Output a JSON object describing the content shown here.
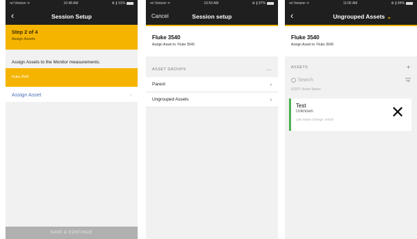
{
  "phone1": {
    "status": {
      "carrier": "•ııl Verizon ᯤ",
      "time": "10:48 AM",
      "battery": "⚙ ∦ 91%"
    },
    "nav": {
      "back": "‹",
      "title": "Session Setup"
    },
    "step": {
      "title": "Step 2 of 4",
      "subtitle": "Assign Assets"
    },
    "instruction": "Assign Assets to the Monitor measurements.",
    "selected_item": "Fluke 3540",
    "assign_label": "Assign Asset",
    "assign_arrow": "›",
    "save_button": "SAVE & CONTINUE",
    "accent_color": "#f5b400"
  },
  "phone2": {
    "status": {
      "carrier": "•ııl Verizon ᯤ",
      "time": "10:59 AM",
      "battery": "⚙ ∦ 87%"
    },
    "nav": {
      "cancel": "Cancel",
      "title": "Session setup"
    },
    "asset": {
      "name": "Fluke 3540",
      "assign": "Assign Asset to: Fluke 3540"
    },
    "groups_header": "ASSET GROUPS",
    "groups_menu": "···",
    "groups": [
      {
        "label": "Parent",
        "arrow": "›"
      },
      {
        "label": "Ungrouped Assets",
        "arrow": "›"
      }
    ]
  },
  "phone3": {
    "status": {
      "carrier": "•ııl Verizon ᯤ",
      "time": "11:06 AM",
      "battery": "⚙ ∦ 84%"
    },
    "nav": {
      "back": "‹",
      "title": "Ungrouped Assets",
      "chevron": "⌄"
    },
    "asset": {
      "name": "Fluke 3540",
      "assign": "Assign Asset to: Fluke 3540"
    },
    "assets_header": "ASSETS",
    "add_icon": "+",
    "search_placeholder": "Search",
    "sort_label": "SORT: Asset Name",
    "card": {
      "name": "Test",
      "status": "Unknown",
      "last_change": "Last Status Change: 4/4/18",
      "close": "✕",
      "status_color": "#4caf50"
    }
  }
}
